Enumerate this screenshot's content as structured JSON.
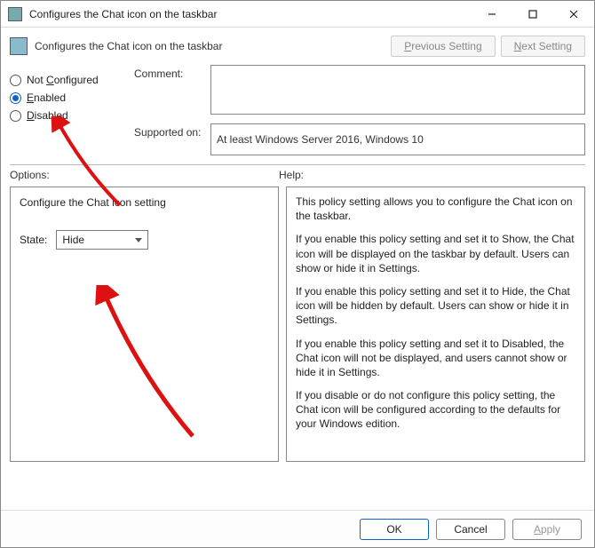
{
  "titlebar": {
    "title": "Configures the Chat icon on the taskbar"
  },
  "header": {
    "title": "Configures the Chat icon on the taskbar",
    "prev_setting": "Previous Setting",
    "next_setting": "Next Setting"
  },
  "radios": {
    "not_configured": "Not Configured",
    "enabled": "Enabled",
    "disabled": "Disabled",
    "selected": "enabled"
  },
  "fields": {
    "comment_label": "Comment:",
    "supported_label": "Supported on:",
    "supported_value": "At least Windows Server 2016, Windows 10"
  },
  "labels": {
    "options": "Options:",
    "help": "Help:"
  },
  "options": {
    "title": "Configure the Chat icon setting",
    "state_label": "State:",
    "state_value": "Hide"
  },
  "help": {
    "p1": "This policy setting allows you to configure the Chat icon on the taskbar.",
    "p2": "If you enable this policy setting and set it to Show, the Chat icon will be displayed on the taskbar by default. Users can show or hide it in Settings.",
    "p3": "If you enable this policy setting and set it to Hide, the Chat icon will be hidden by default. Users can show or hide it in Settings.",
    "p4": "If you enable this policy setting and set it to Disabled, the Chat icon will not be displayed, and users cannot show or hide it in Settings.",
    "p5": "If you disable or do not configure this policy setting, the Chat icon will be configured according to the defaults for your Windows edition."
  },
  "footer": {
    "ok": "OK",
    "cancel": "Cancel",
    "apply": "Apply"
  }
}
